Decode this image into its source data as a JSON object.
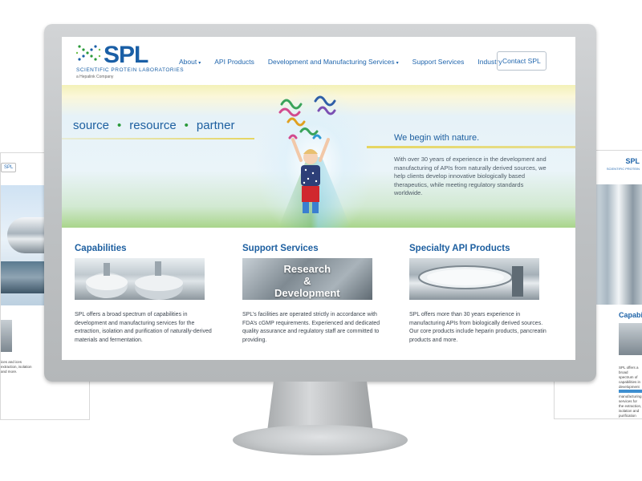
{
  "bg_left": {
    "contact_fragment": "SPL",
    "body_fragment": "ices and ices extraction, isolation and more."
  },
  "bg_right": {
    "logo": "SPL",
    "logo_sub": "SCIENTIFIC PROTEIN",
    "logo_sub2": "a Hepalink Company",
    "section_title": "Capabilities",
    "body_fragment": "SPL offers a broad spectrum of capabilities in development and manufacturing services for the extraction, isolation and purification"
  },
  "header": {
    "logo_text": "SPL",
    "logo_subtitle": "SCIENTIFIC PROTEIN LABORATORIES",
    "logo_tagline": "a Hepalink Company",
    "nav": [
      {
        "label": "About",
        "dropdown": true
      },
      {
        "label": "API Products",
        "dropdown": false
      },
      {
        "label": "Development and Manufacturing Services",
        "dropdown": true
      },
      {
        "label": "Support Services",
        "dropdown": false
      },
      {
        "label": "Industry",
        "dropdown": false
      }
    ],
    "contact_label": "Contact SPL",
    "caret": "▾"
  },
  "hero": {
    "tag_1": "source",
    "tag_2": "resource",
    "tag_3": "partner",
    "dot": "•",
    "heading": "We begin with nature.",
    "body": "With over 30 years of experience in the development and manufacturing of APIs from naturally derived sources, we help clients develop innovative biologically based therapeutics, while meeting regulatory standards worldwide."
  },
  "sections": [
    {
      "title": "Capabilities",
      "body": "SPL offers a broad spectrum of capabilities in development and manufacturing services for the extraction, isolation and purification of naturally-derived materials and fermentation."
    },
    {
      "title": "Support Services",
      "image_text_1": "Research",
      "image_text_2": "&",
      "image_text_3": "Development",
      "body": "SPL’s facilities are operated strictly in accordance with FDA’s cGMP requirements. Experienced and dedicated quality assurance and regulatory staff are committed to providing."
    },
    {
      "title": "Specialty API Products",
      "body": "SPL offers more than 30 years experience in manufacturing APIs from biologically derived sources. Our core products include heparin products, pancreatin products and more."
    }
  ],
  "colors": {
    "brand_blue": "#1d5fa0",
    "accent_green": "#2a9a3a"
  }
}
